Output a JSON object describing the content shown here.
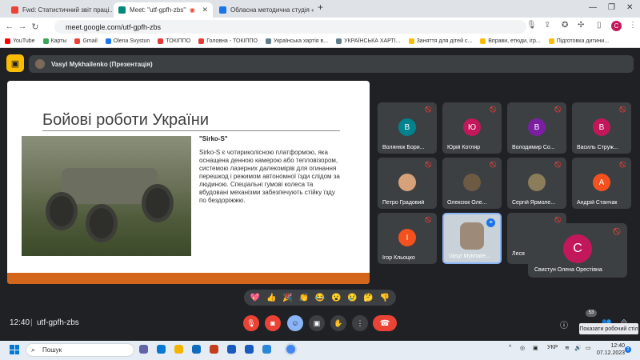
{
  "browser": {
    "tabs": [
      {
        "title": "Fwd: Статистичний звіт праці...",
        "fav_color": "#ea4335",
        "active": false
      },
      {
        "title": "Meet: \"utf-gpfh-zbs\"",
        "fav_color": "#00897b",
        "active": true
      },
      {
        "title": "Обласна методична студія «В...",
        "fav_color": "#1a73e8",
        "active": false
      }
    ],
    "new_tab": "+",
    "url": "meet.google.com/utf-gpfh-zbs",
    "profile_initial": "C",
    "bookmarks": [
      "YouTube",
      "Карты",
      "Gmail",
      "Olena Svystun",
      "ТОКІППО",
      "Головна - ТОКІППО",
      "Українська хартія в...",
      "УКРАЇНСЬКА ХАРТІ...",
      "Заняття для дітей с...",
      "Вправи, етюди, ігр...",
      "Підготовка дитини..."
    ]
  },
  "meet": {
    "presenter_label": "Vasyl Mykhailenko (Презентація)",
    "slide": {
      "title": "Бойові роботи України",
      "subtitle": "\"Sirko-S\"",
      "body": "Sirko-S є чотириколісною платформою, яка оснащена денною камерою або тепловізором, системою лазерних далекомірів для огинання перешкод і режимом автономної їзди слідом за людиною. Спеціальні гумові колеса та вбудовані механізми забезпечують стійку їзду по бездоріжжю."
    },
    "participants": [
      {
        "name": "Волянюк Бори...",
        "initial": "В",
        "color": "#00838f"
      },
      {
        "name": "Юрій Котляр",
        "initial": "Ю",
        "color": "#c2185b"
      },
      {
        "name": "Володимир Со...",
        "initial": "В",
        "color": "#7b1fa2"
      },
      {
        "name": "Василь Струж...",
        "initial": "В",
        "color": "#c2185b"
      },
      {
        "name": "Петро Градовий",
        "initial": "",
        "color": "#d7a27a"
      },
      {
        "name": "Олексюк Оле...",
        "initial": "",
        "color": "#6d5a43"
      },
      {
        "name": "Сергій Ярмоле...",
        "initial": "",
        "color": "#8b7d5a"
      },
      {
        "name": "Андрій Станчак",
        "initial": "А",
        "color": "#f4511e"
      },
      {
        "name": "Ігор Кльоцко",
        "initial": "І",
        "color": "#f4511e"
      },
      {
        "name": "Vasyl Mykhaile...",
        "initial": "",
        "color": "#9e8a78"
      },
      {
        "name": "Леся",
        "initial": "",
        "color": "#3c4043"
      }
    ],
    "featured": {
      "name": "Свистун Олена Орестівна",
      "initial": "С"
    },
    "reactions": [
      "💖",
      "👍",
      "🎉",
      "👏",
      "😂",
      "😮",
      "😢",
      "🤔",
      "👎"
    ],
    "time": "12:40",
    "meeting_code": "utf-gpfh-zbs",
    "participants_count": "53",
    "tooltip": "Показати робочий стіл"
  },
  "taskbar": {
    "search_placeholder": "Пошук",
    "language": "УКР",
    "clock_time": "12:40",
    "clock_date": "07.12.2023",
    "notifications": "2"
  }
}
